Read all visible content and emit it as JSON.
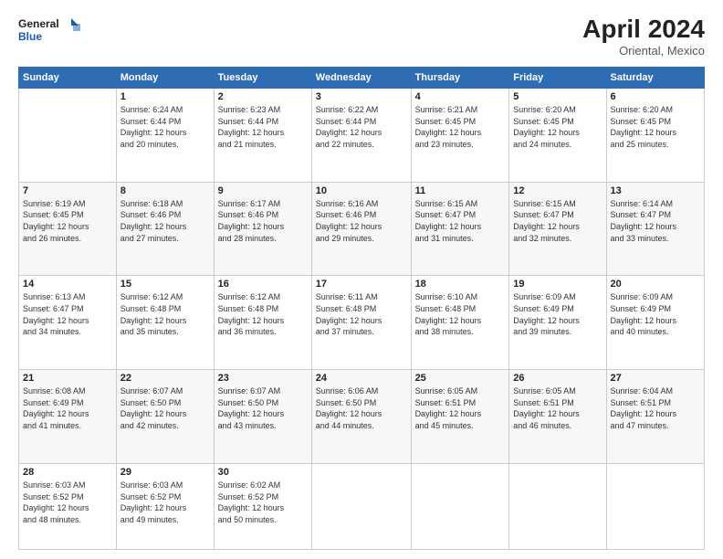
{
  "header": {
    "logo_line1": "General",
    "logo_line2": "Blue",
    "title": "April 2024",
    "subtitle": "Oriental, Mexico"
  },
  "days_of_week": [
    "Sunday",
    "Monday",
    "Tuesday",
    "Wednesday",
    "Thursday",
    "Friday",
    "Saturday"
  ],
  "weeks": [
    [
      {
        "day": "",
        "detail": ""
      },
      {
        "day": "1",
        "detail": "Sunrise: 6:24 AM\nSunset: 6:44 PM\nDaylight: 12 hours\nand 20 minutes."
      },
      {
        "day": "2",
        "detail": "Sunrise: 6:23 AM\nSunset: 6:44 PM\nDaylight: 12 hours\nand 21 minutes."
      },
      {
        "day": "3",
        "detail": "Sunrise: 6:22 AM\nSunset: 6:44 PM\nDaylight: 12 hours\nand 22 minutes."
      },
      {
        "day": "4",
        "detail": "Sunrise: 6:21 AM\nSunset: 6:45 PM\nDaylight: 12 hours\nand 23 minutes."
      },
      {
        "day": "5",
        "detail": "Sunrise: 6:20 AM\nSunset: 6:45 PM\nDaylight: 12 hours\nand 24 minutes."
      },
      {
        "day": "6",
        "detail": "Sunrise: 6:20 AM\nSunset: 6:45 PM\nDaylight: 12 hours\nand 25 minutes."
      }
    ],
    [
      {
        "day": "7",
        "detail": "Sunrise: 6:19 AM\nSunset: 6:45 PM\nDaylight: 12 hours\nand 26 minutes."
      },
      {
        "day": "8",
        "detail": "Sunrise: 6:18 AM\nSunset: 6:46 PM\nDaylight: 12 hours\nand 27 minutes."
      },
      {
        "day": "9",
        "detail": "Sunrise: 6:17 AM\nSunset: 6:46 PM\nDaylight: 12 hours\nand 28 minutes."
      },
      {
        "day": "10",
        "detail": "Sunrise: 6:16 AM\nSunset: 6:46 PM\nDaylight: 12 hours\nand 29 minutes."
      },
      {
        "day": "11",
        "detail": "Sunrise: 6:15 AM\nSunset: 6:47 PM\nDaylight: 12 hours\nand 31 minutes."
      },
      {
        "day": "12",
        "detail": "Sunrise: 6:15 AM\nSunset: 6:47 PM\nDaylight: 12 hours\nand 32 minutes."
      },
      {
        "day": "13",
        "detail": "Sunrise: 6:14 AM\nSunset: 6:47 PM\nDaylight: 12 hours\nand 33 minutes."
      }
    ],
    [
      {
        "day": "14",
        "detail": "Sunrise: 6:13 AM\nSunset: 6:47 PM\nDaylight: 12 hours\nand 34 minutes."
      },
      {
        "day": "15",
        "detail": "Sunrise: 6:12 AM\nSunset: 6:48 PM\nDaylight: 12 hours\nand 35 minutes."
      },
      {
        "day": "16",
        "detail": "Sunrise: 6:12 AM\nSunset: 6:48 PM\nDaylight: 12 hours\nand 36 minutes."
      },
      {
        "day": "17",
        "detail": "Sunrise: 6:11 AM\nSunset: 6:48 PM\nDaylight: 12 hours\nand 37 minutes."
      },
      {
        "day": "18",
        "detail": "Sunrise: 6:10 AM\nSunset: 6:48 PM\nDaylight: 12 hours\nand 38 minutes."
      },
      {
        "day": "19",
        "detail": "Sunrise: 6:09 AM\nSunset: 6:49 PM\nDaylight: 12 hours\nand 39 minutes."
      },
      {
        "day": "20",
        "detail": "Sunrise: 6:09 AM\nSunset: 6:49 PM\nDaylight: 12 hours\nand 40 minutes."
      }
    ],
    [
      {
        "day": "21",
        "detail": "Sunrise: 6:08 AM\nSunset: 6:49 PM\nDaylight: 12 hours\nand 41 minutes."
      },
      {
        "day": "22",
        "detail": "Sunrise: 6:07 AM\nSunset: 6:50 PM\nDaylight: 12 hours\nand 42 minutes."
      },
      {
        "day": "23",
        "detail": "Sunrise: 6:07 AM\nSunset: 6:50 PM\nDaylight: 12 hours\nand 43 minutes."
      },
      {
        "day": "24",
        "detail": "Sunrise: 6:06 AM\nSunset: 6:50 PM\nDaylight: 12 hours\nand 44 minutes."
      },
      {
        "day": "25",
        "detail": "Sunrise: 6:05 AM\nSunset: 6:51 PM\nDaylight: 12 hours\nand 45 minutes."
      },
      {
        "day": "26",
        "detail": "Sunrise: 6:05 AM\nSunset: 6:51 PM\nDaylight: 12 hours\nand 46 minutes."
      },
      {
        "day": "27",
        "detail": "Sunrise: 6:04 AM\nSunset: 6:51 PM\nDaylight: 12 hours\nand 47 minutes."
      }
    ],
    [
      {
        "day": "28",
        "detail": "Sunrise: 6:03 AM\nSunset: 6:52 PM\nDaylight: 12 hours\nand 48 minutes."
      },
      {
        "day": "29",
        "detail": "Sunrise: 6:03 AM\nSunset: 6:52 PM\nDaylight: 12 hours\nand 49 minutes."
      },
      {
        "day": "30",
        "detail": "Sunrise: 6:02 AM\nSunset: 6:52 PM\nDaylight: 12 hours\nand 50 minutes."
      },
      {
        "day": "",
        "detail": ""
      },
      {
        "day": "",
        "detail": ""
      },
      {
        "day": "",
        "detail": ""
      },
      {
        "day": "",
        "detail": ""
      }
    ]
  ]
}
